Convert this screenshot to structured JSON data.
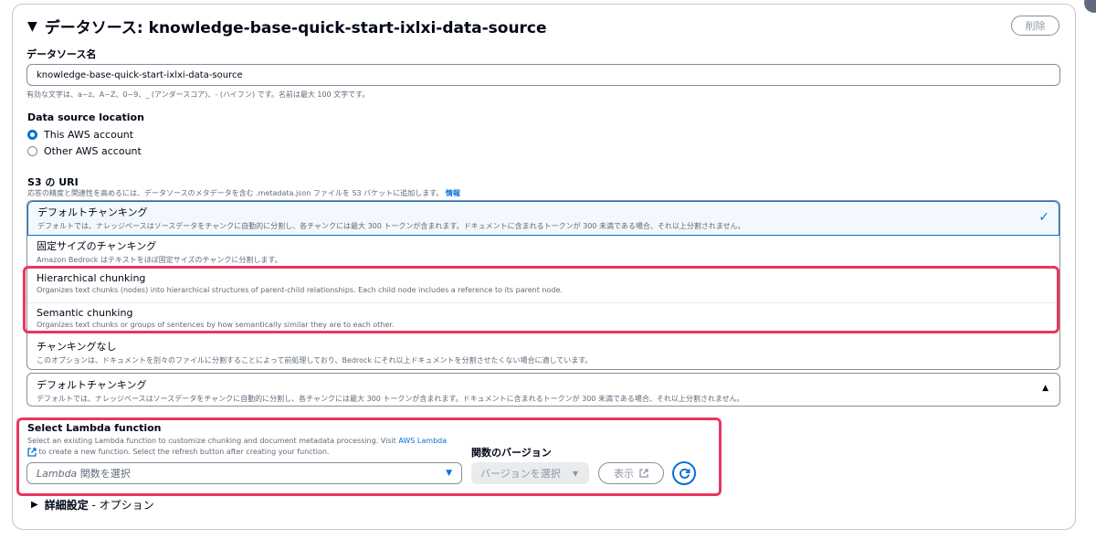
{
  "header": {
    "title": "データソース: knowledge-base-quick-start-ixlxi-data-source",
    "delete_label": "削除"
  },
  "name_field": {
    "label": "データソース名",
    "value": "knowledge-base-quick-start-ixlxi-data-source",
    "hint": "有効な文字は、a~z、A~Z、0~9、_ (アンダースコア)、- (ハイフン) です。名前は最大 100 文字です。"
  },
  "location": {
    "label": "Data source location",
    "options": [
      {
        "label": "This AWS account",
        "selected": true
      },
      {
        "label": "Other AWS account",
        "selected": false
      }
    ]
  },
  "s3": {
    "label": "S3 の URI",
    "hint": "応答の精度と関連性を高めるには、データソースのメタデータを含む .metadata.json ファイルを S3 バケットに追加します。",
    "info_link": "情報"
  },
  "chunking_options": [
    {
      "title": "デフォルトチャンキング",
      "desc": "デフォルトでは、ナレッジベースはソースデータをチャンクに自動的に分割し、各チャンクには最大 300 トークンが含まれます。ドキュメントに含まれるトークンが 300 未満である場合、それ以上分割されません。"
    },
    {
      "title": "固定サイズのチャンキング",
      "desc": "Amazon Bedrock はテキストをほぼ固定サイズのチャンクに分割します。"
    },
    {
      "title": "Hierarchical chunking",
      "desc": "Organizes text chunks (nodes) into hierarchical structures of parent-child relationships. Each child node includes a reference to its parent node."
    },
    {
      "title": "Semantic chunking",
      "desc": "Organizes text chunks or groups of sentences by how semantically similar they are to each other."
    },
    {
      "title": "チャンキングなし",
      "desc": "このオプションは、ドキュメントを別々のファイルに分割することによって前処理しており、Bedrock にそれ以上ドキュメントを分割させたくない場合に適しています。"
    }
  ],
  "selected_chunking": {
    "title": "デフォルトチャンキング",
    "desc": "デフォルトでは、ナレッジベースはソースデータをチャンクに自動的に分割し、各チャンクには最大 300 トークンが含まれます。ドキュメントに含まれるトークンが 300 未満である場合、それ以上分割されません。"
  },
  "lambda": {
    "label": "Select Lambda function",
    "desc_part1": "Select an existing Lambda function to customize chunking and document metadata processing. Visit",
    "desc_link": "AWS Lambda",
    "desc_part2": "to create a new function. Select the refresh button after creating your function.",
    "select_placeholder_italic": "Lambda",
    "select_placeholder_rest": " 関数を選択",
    "version_label": "関数のバージョン",
    "version_placeholder": "バージョンを選択",
    "show_label": "表示"
  },
  "advanced": {
    "label_bold": "詳細設定",
    "label_rest": " - オプション"
  },
  "colors": {
    "accent": "#0972d3",
    "highlight": "#e8375f"
  }
}
